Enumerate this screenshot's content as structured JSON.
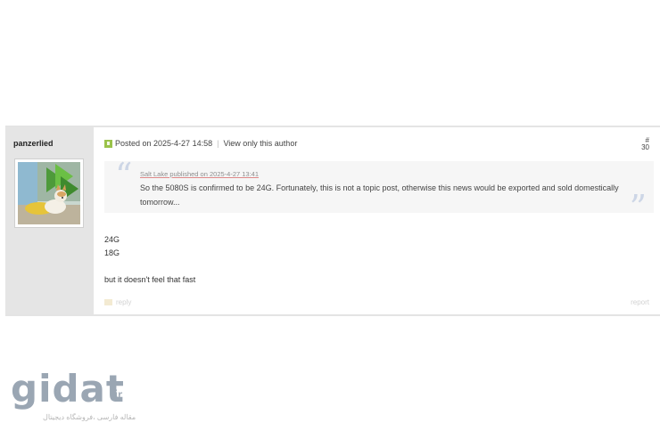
{
  "post": {
    "author": "panzerlied",
    "meta": {
      "posted_on": "Posted on 2025-4-27 14:58",
      "separator": "|",
      "view_only_author": "View only this author"
    },
    "floor": {
      "hash": "#",
      "number": "30"
    },
    "quote": {
      "open_mark": "“",
      "close_mark": "”",
      "source": "Salt Lake published on 2025-4-27 13:41",
      "text": "So the 5080S is confirmed to be 24G. Fortunately, this is not a topic post, otherwise this news would be exported and sold domestically tomorrow..."
    },
    "body": [
      "24G",
      "18G",
      "but it doesn't feel that fast"
    ],
    "actions": {
      "reply": "reply",
      "report": "report"
    },
    "colors": {
      "author_bg": "#e5e5e5",
      "quote_bg": "#f6f6f6",
      "indicator": "#9ac24a"
    },
    "icons": {
      "online_indicator": "user-status-icon",
      "reply": "reply-icon"
    }
  },
  "watermark": {
    "brand": "gidat",
    "tld": ".ir",
    "tagline": "مقاله فارسی ،فروشگاه دیجیتال"
  }
}
